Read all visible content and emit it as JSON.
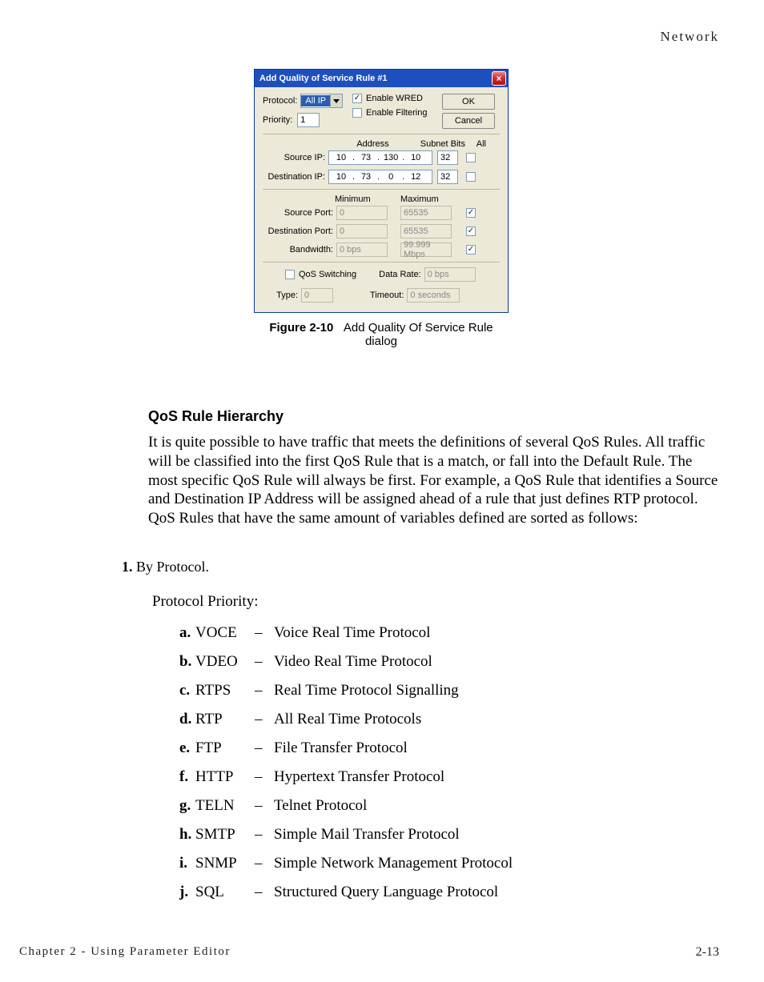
{
  "header": {
    "section": "Network"
  },
  "dialog": {
    "title": "Add Quality of Service Rule #1",
    "buttons": {
      "ok": "OK",
      "cancel": "Cancel"
    },
    "protocol": {
      "label": "Protocol:",
      "value": "All IP"
    },
    "priority": {
      "label": "Priority:",
      "value": "1"
    },
    "enable_wred": {
      "label": "Enable WRED"
    },
    "enable_filtering": {
      "label": "Enable Filtering"
    },
    "headers": {
      "address": "Address",
      "subnet_bits": "Subnet Bits",
      "all": "All",
      "minimum": "Minimum",
      "maximum": "Maximum"
    },
    "source_ip": {
      "label": "Source IP:",
      "o1": "10",
      "o2": "73",
      "o3": "130",
      "o4": "10",
      "bits": "32"
    },
    "dest_ip": {
      "label": "Destination IP:",
      "o1": "10",
      "o2": "73",
      "o3": "0",
      "o4": "12",
      "bits": "32"
    },
    "source_port": {
      "label": "Source Port:",
      "min": "0",
      "max": "65535"
    },
    "dest_port": {
      "label": "Destination Port:",
      "min": "0",
      "max": "65535"
    },
    "bandwidth": {
      "label": "Bandwidth:",
      "min": "0 bps",
      "max": "99.999 Mbps"
    },
    "qos_switching": {
      "label": "QoS Switching"
    },
    "data_rate": {
      "label": "Data Rate:",
      "value": "0 bps"
    },
    "type": {
      "label": "Type:",
      "value": "0"
    },
    "timeout": {
      "label": "Timeout:",
      "value": "0 seconds"
    }
  },
  "figure": {
    "num": "Figure 2-10",
    "caption": "Add Quality Of Service Rule dialog"
  },
  "section": {
    "heading": "QoS Rule Hierarchy",
    "para": "It is quite possible to have traffic that meets the definitions of several QoS Rules. All traffic will be classified into the first QoS Rule that is a match, or fall into the Default Rule. The most specific QoS Rule will always be first. For example, a QoS Rule that identifies a Source and Destination IP Address will be assigned ahead of a rule that just defines RTP protocol. QoS Rules that have the same amount of variables defined are sorted as follows:",
    "num1_letter": "1.",
    "num1_text": "By Protocol.",
    "pp": "Protocol Priority:",
    "list": [
      {
        "l": "a.",
        "a": "VOCE",
        "d": "–",
        "t": "Voice Real Time Protocol"
      },
      {
        "l": "b.",
        "a": "VDEO",
        "d": "–",
        "t": "Video Real Time Protocol"
      },
      {
        "l": "c.",
        "a": "RTPS",
        "d": "–",
        "t": "Real Time Protocol Signalling"
      },
      {
        "l": "d.",
        "a": "RTP",
        "d": "–",
        "t": "All Real Time Protocols"
      },
      {
        "l": "e.",
        "a": "FTP",
        "d": "–",
        "t": "File Transfer Protocol"
      },
      {
        "l": "f.",
        "a": "HTTP",
        "d": "–",
        "t": "Hypertext Transfer Protocol"
      },
      {
        "l": "g.",
        "a": "TELN",
        "d": "–",
        "t": "Telnet Protocol"
      },
      {
        "l": "h.",
        "a": "SMTP",
        "d": "–",
        "t": "Simple Mail Transfer Protocol"
      },
      {
        "l": "i.",
        "a": "SNMP",
        "d": "–",
        "t": "Simple Network Management Protocol"
      },
      {
        "l": "j.",
        "a": "SQL",
        "d": "–",
        "t": "Structured Query Language Protocol"
      }
    ]
  },
  "footer": {
    "chapter": "Chapter 2 - Using Parameter Editor",
    "page": "2-13"
  }
}
